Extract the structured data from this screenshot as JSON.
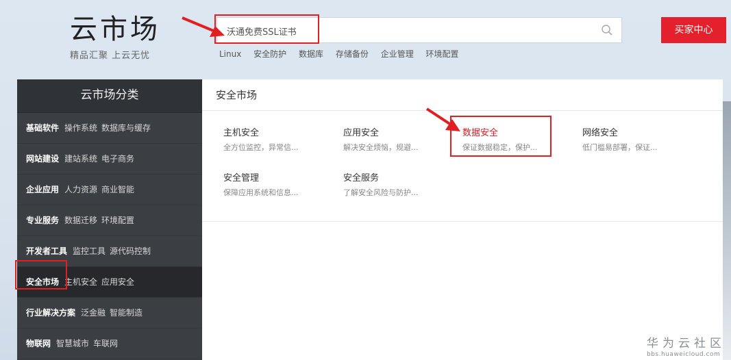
{
  "logo": {
    "title": "云市场",
    "subtitle": "精品汇聚  上云无忧"
  },
  "search": {
    "value": "沃通免费SSL证书",
    "icon": "search-icon"
  },
  "buy_button": {
    "label": "买家中心",
    "color": "#e3202b"
  },
  "hot_links": [
    "Linux",
    "安全防护",
    "数据库",
    "存储备份",
    "企业管理",
    "环境配置"
  ],
  "sidebar": {
    "title": "云市场分类",
    "categories": [
      {
        "label": "基础软件",
        "subs": [
          "操作系统",
          "数据库与缓存"
        ]
      },
      {
        "label": "网站建设",
        "subs": [
          "建站系统",
          "电子商务"
        ]
      },
      {
        "label": "企业应用",
        "subs": [
          "人力资源",
          "商业智能"
        ]
      },
      {
        "label": "专业服务",
        "subs": [
          "数据迁移",
          "环境配置"
        ]
      },
      {
        "label": "开发者工具",
        "subs": [
          "监控工具",
          "源代码控制"
        ]
      },
      {
        "label": "安全市场",
        "subs": [
          "主机安全",
          "应用安全"
        ],
        "active": true
      },
      {
        "label": "行业解决方案",
        "subs": [
          "泛金融",
          "智能制造"
        ]
      },
      {
        "label": "物联网",
        "subs": [
          "智慧城市",
          "车联网"
        ]
      }
    ]
  },
  "panel": {
    "title": "安全市场",
    "items": [
      {
        "title": "主机安全",
        "desc": "全方位监控，异常信..."
      },
      {
        "title": "应用安全",
        "desc": "解决安全烦恼，规避..."
      },
      {
        "title": "数据安全",
        "desc": "保证数据稳定，保护...",
        "highlight": true
      },
      {
        "title": "网络安全",
        "desc": "低门槛易部署，保证..."
      },
      {
        "title": "安全管理",
        "desc": "保障应用系统和信息..."
      },
      {
        "title": "安全服务",
        "desc": "了解安全风险与防护..."
      }
    ]
  },
  "watermark": {
    "main": "华为云社区",
    "sub": "bbs.huaweicloud.com"
  },
  "annotation_color": "#e02020"
}
